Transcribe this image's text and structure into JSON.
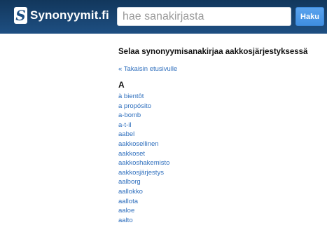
{
  "header": {
    "logo_glyph": "S",
    "logo_text": "Synonyymit.fi",
    "search_placeholder": "hae sanakirjasta",
    "search_button_label": "Haku"
  },
  "main": {
    "title": "Selaa synonyymisanakirjaa aakkosjärjestyksessä",
    "back_link": "« Takaisin etusivulle",
    "letter": "A",
    "words": [
      "à bientôt",
      "a propósito",
      "a-bomb",
      "a-t-il",
      "aabel",
      "aakkosellinen",
      "aakkoset",
      "aakkoshakemisto",
      "aakkosjärjestys",
      "aalborg",
      "aallokko",
      "aallota",
      "aaloe",
      "aalto"
    ]
  },
  "colors": {
    "header_bg": "#1e4f82",
    "link": "#2f6fbd",
    "button": "#4a95e6"
  }
}
